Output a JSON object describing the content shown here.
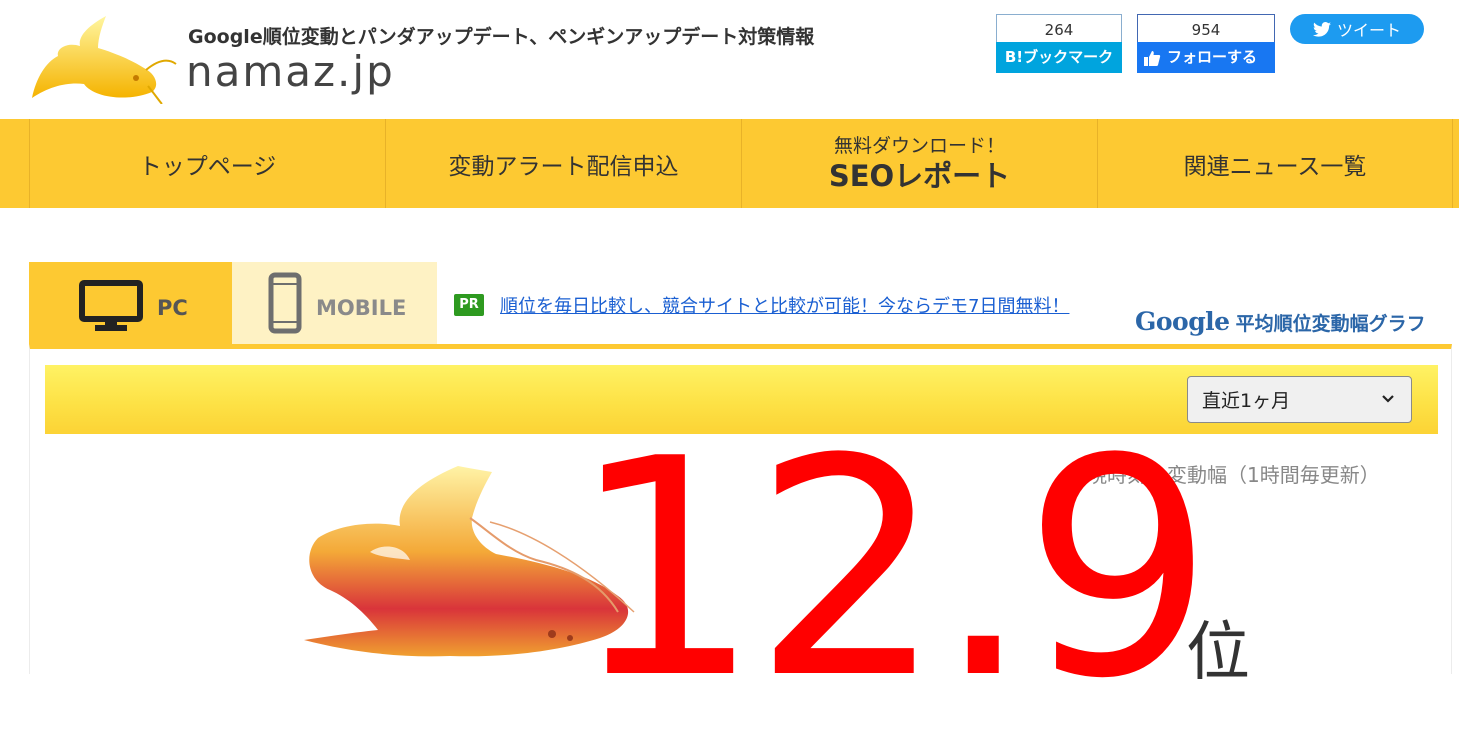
{
  "header": {
    "tagline": "Google順位変動とパンダアップデート、ペンギンアップデート対策情報",
    "site_name": "namaz.jp",
    "logo_icon": "catfish-logo-icon"
  },
  "social": {
    "hatena": {
      "count": "264",
      "label": "ブックマーク",
      "prefix": "B!"
    },
    "facebook": {
      "count": "954",
      "label": "フォローする",
      "icon": "thumbs-up-icon"
    },
    "twitter": {
      "label": "ツイート",
      "icon": "twitter-bird-icon"
    }
  },
  "nav": {
    "items": [
      {
        "label": "トップページ"
      },
      {
        "label": "変動アラート配信申込"
      },
      {
        "small": "無料ダウンロード！",
        "big": "SEOレポート"
      },
      {
        "label": "関連ニュース一覧"
      }
    ]
  },
  "tabs": {
    "pc": {
      "label": "PC",
      "icon": "monitor-icon"
    },
    "mobile": {
      "label": "MOBILE",
      "icon": "smartphone-icon"
    }
  },
  "pr": {
    "badge": "PR",
    "link_text": "順位を毎日比較し、競合サイトと比較が可能！今ならデモ7日間無料！"
  },
  "graph_title": {
    "brand": "Google",
    "text": "平均順位変動幅グラフ"
  },
  "controls": {
    "period_selected": "直近1ヶ月"
  },
  "summary": {
    "note": "現時刻の変動幅（1時間毎更新）",
    "value": "12.9",
    "unit": "位"
  },
  "colors": {
    "nav_yellow": "#fdc932",
    "value_red": "#ff0000",
    "hatena_blue": "#00a4de",
    "facebook_blue": "#1877f2",
    "twitter_blue": "#1d9bf0",
    "pr_green": "#2e9a20"
  }
}
